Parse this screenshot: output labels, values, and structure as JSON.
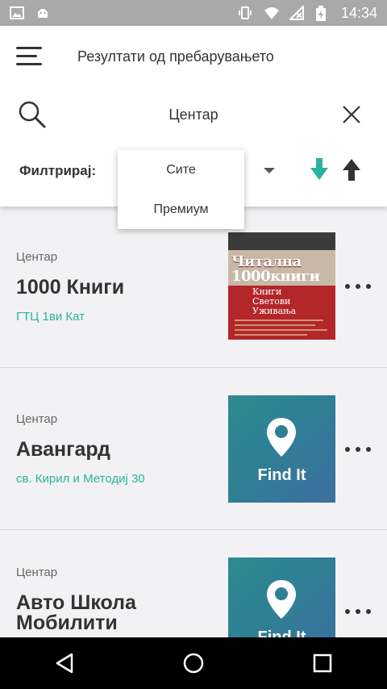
{
  "status_bar": {
    "time": "14:34"
  },
  "header": {
    "title": "Резултати од пребарувањето",
    "search_value": "Центар",
    "filter_label": "Филтрирај:"
  },
  "dropdown": {
    "options": [
      "Сите",
      "Премиум"
    ]
  },
  "results": [
    {
      "category": "Центар",
      "name": "1000 Книги",
      "address": "ГТЦ 1ви Кат",
      "thumb": "book-cover"
    },
    {
      "category": "Центар",
      "name": "Авангард",
      "address": "св. Кирил и Методиј 30",
      "thumb": "findit-placeholder"
    },
    {
      "category": "Центар",
      "name": "Авто Школа Мобилити",
      "address": "",
      "thumb": "findit-placeholder"
    }
  ],
  "thumbs": {
    "findit_text": "Find It",
    "book_line1": "Читална",
    "book_line2": "1000книги",
    "book_sub1": "Книги",
    "book_sub2": "Светови",
    "book_sub3": "Уживања"
  },
  "colors": {
    "accent": "#2bb39c",
    "sort_down": "#26b3a0",
    "status_bar": "#a9a9a9"
  }
}
